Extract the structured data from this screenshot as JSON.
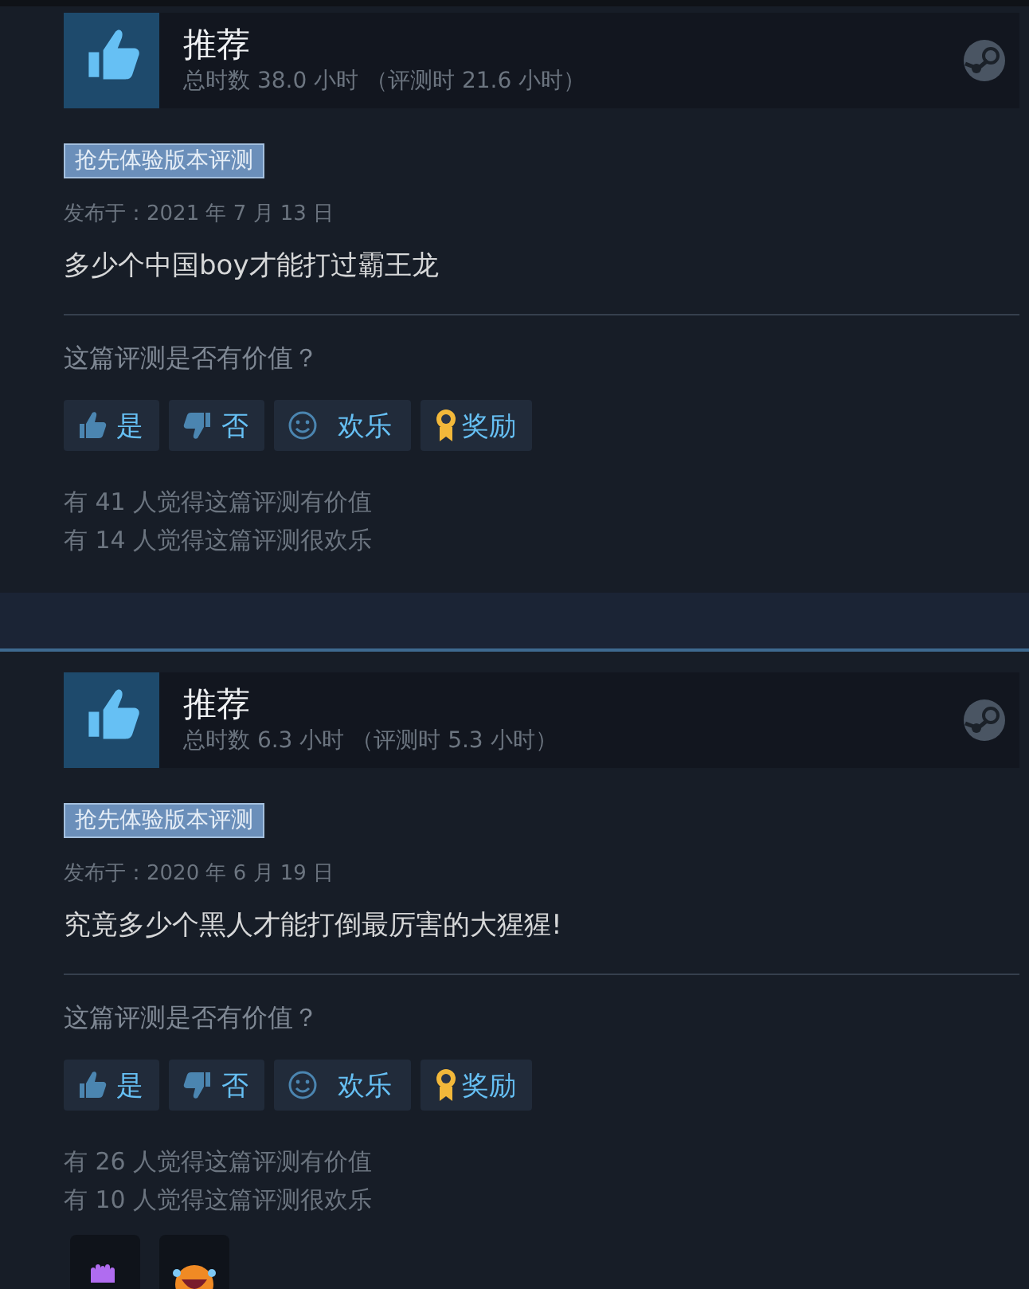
{
  "reviews": [
    {
      "verdict": "推荐",
      "recommended": true,
      "hours": "总时数 38.0 小时 （评测时 21.6 小时）",
      "badge": "抢先体验版本评测",
      "date": "发布于：2021 年 7 月 13 日",
      "text": "多少个中国boy才能打过霸王龙",
      "question": "这篇评测是否有价值？",
      "buttons": [
        {
          "kind": "yes",
          "label": "是"
        },
        {
          "kind": "no",
          "label": "否"
        },
        {
          "kind": "funny",
          "label": "欢乐"
        },
        {
          "kind": "award",
          "label": "奖励"
        }
      ],
      "stats": [
        "有 41 人觉得这篇评测有价值",
        "有 14 人觉得这篇评测很欢乐"
      ]
    },
    {
      "verdict": "推荐",
      "recommended": true,
      "hours": "总时数 6.3 小时 （评测时 5.3 小时）",
      "badge": "抢先体验版本评测",
      "date": "发布于：2020 年 6 月 19 日",
      "text": "究竟多少个黑人才能打倒最厉害的大猩猩!",
      "question": "这篇评测是否有价值？",
      "buttons": [
        {
          "kind": "yes",
          "label": "是"
        },
        {
          "kind": "no",
          "label": "否"
        },
        {
          "kind": "funny",
          "label": "欢乐"
        },
        {
          "kind": "award",
          "label": "奖励"
        }
      ],
      "stats": [
        "有 26 人觉得这篇评测有价值",
        "有 10 人觉得这篇评测很欢乐"
      ],
      "awards": [
        {
          "kind": "hands"
        },
        {
          "kind": "laugh"
        }
      ]
    }
  ]
}
